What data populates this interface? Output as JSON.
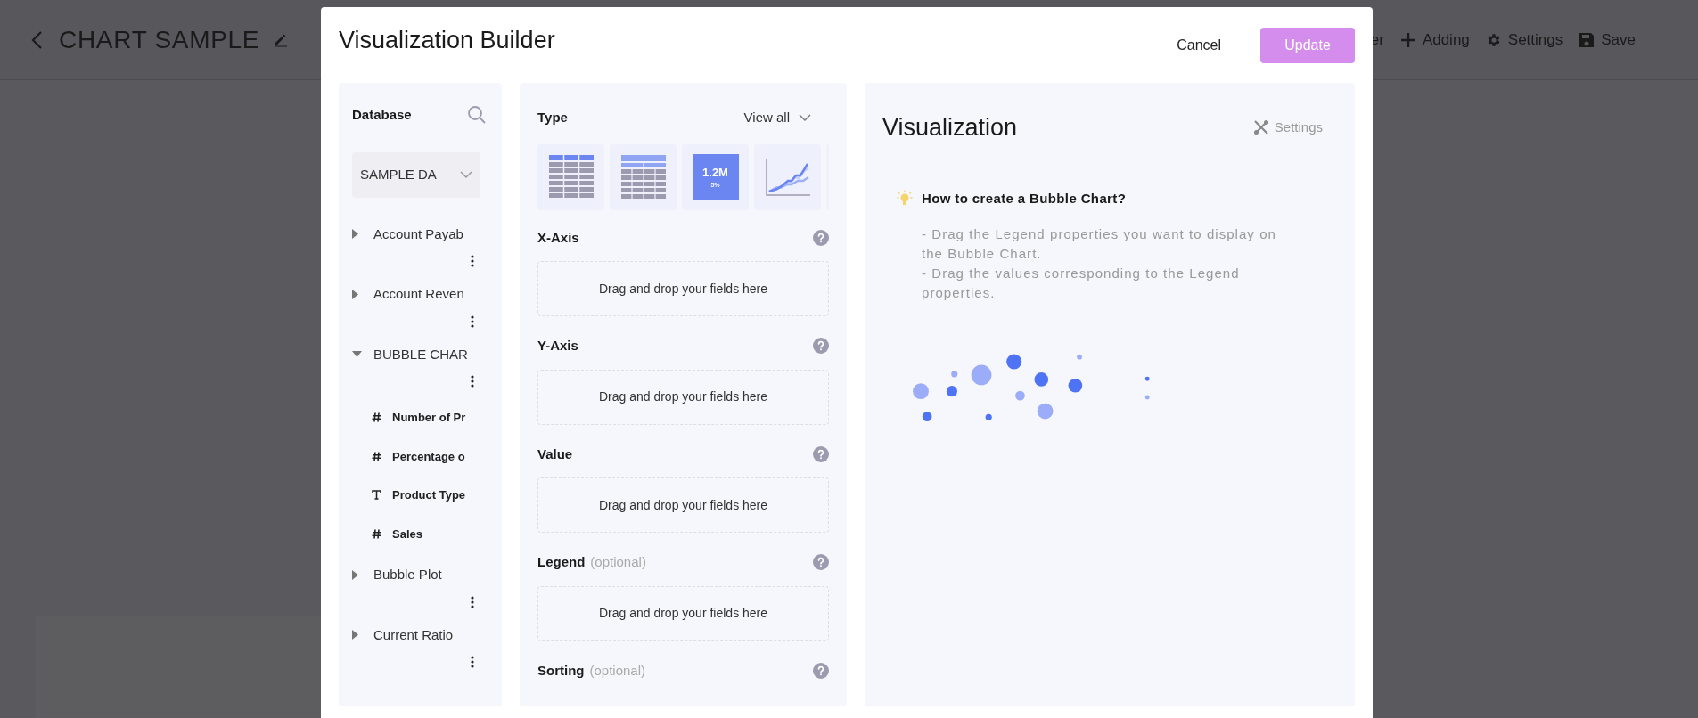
{
  "page": {
    "title": "CHART SAMPLE",
    "toolbar": [
      {
        "kind": "partial",
        "label": "er"
      },
      {
        "kind": "add",
        "label": "Adding"
      },
      {
        "kind": "settings",
        "label": "Settings"
      },
      {
        "kind": "save",
        "label": "Save"
      }
    ]
  },
  "dialog": {
    "title": "Visualization Builder",
    "cancel": "Cancel",
    "confirm": "Update",
    "database": {
      "title": "Database",
      "source": "SAMPLE DA",
      "tables": [
        {
          "name": "Account Payab",
          "expanded": false
        },
        {
          "name": "Account Reven",
          "expanded": false
        },
        {
          "name": "BUBBLE CHAR",
          "expanded": true,
          "children": [
            {
              "name": "Number of Pr",
              "kind": "number"
            },
            {
              "name": "Percentage o",
              "kind": "number"
            },
            {
              "name": "Product Type",
              "kind": "text"
            },
            {
              "name": "Sales",
              "kind": "number"
            }
          ]
        },
        {
          "name": "Bubble Plot",
          "expanded": false
        },
        {
          "name": "Current Ratio",
          "expanded": false
        }
      ]
    },
    "type": {
      "title": "Type",
      "view_all": "View all",
      "chart_types": [
        {
          "kind": "table"
        },
        {
          "kind": "pivot"
        },
        {
          "kind": "kpi",
          "value": "1.2M",
          "change": "5%"
        },
        {
          "kind": "line"
        }
      ]
    },
    "fields": [
      {
        "label": "X-Axis",
        "hint": "Drag and drop your fields here"
      },
      {
        "label": "Y-Axis",
        "hint": "Drag and drop your fields here"
      },
      {
        "label": "Value",
        "hint": "Drag and drop your fields here"
      },
      {
        "label": "Legend",
        "note": "(optional)",
        "hint": "Drag and drop your fields here"
      },
      {
        "label": "Sorting",
        "note": "(optional)"
      }
    ],
    "visualization": {
      "title": "Visualization",
      "settings": "Settings",
      "tip_title": "How to create a Bubble Chart?",
      "tip_lines": [
        "- Drag the Legend properties you want to display on the Bubble Chart.",
        "- Drag the values corresponding to the Legend properties."
      ]
    }
  }
}
